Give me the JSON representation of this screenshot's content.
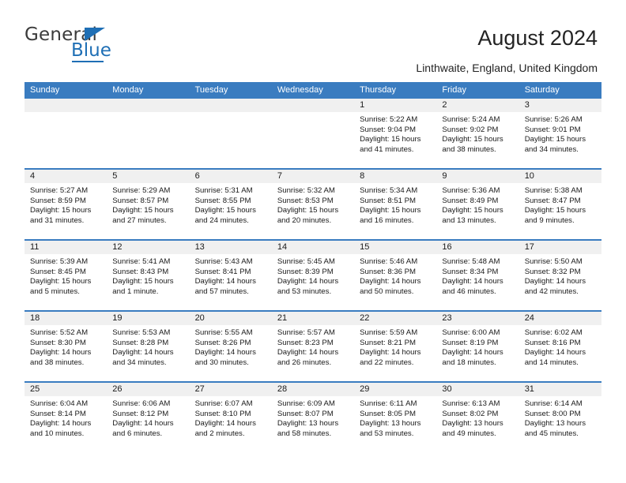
{
  "brand": {
    "name_part1": "General",
    "name_part2": "Blue",
    "accent_color": "#1f6fb5"
  },
  "header": {
    "title": "August 2024",
    "subtitle": "Linthwaite, England, United Kingdom"
  },
  "calendar": {
    "header_bg": "#3a7cc0",
    "daynum_bg": "#f0f0f0",
    "weekdays": [
      "Sunday",
      "Monday",
      "Tuesday",
      "Wednesday",
      "Thursday",
      "Friday",
      "Saturday"
    ],
    "weeks": [
      [
        {
          "day": "",
          "sunrise": "",
          "sunset": "",
          "daylight_line1": "",
          "daylight_line2": ""
        },
        {
          "day": "",
          "sunrise": "",
          "sunset": "",
          "daylight_line1": "",
          "daylight_line2": ""
        },
        {
          "day": "",
          "sunrise": "",
          "sunset": "",
          "daylight_line1": "",
          "daylight_line2": ""
        },
        {
          "day": "",
          "sunrise": "",
          "sunset": "",
          "daylight_line1": "",
          "daylight_line2": ""
        },
        {
          "day": "1",
          "sunrise": "Sunrise: 5:22 AM",
          "sunset": "Sunset: 9:04 PM",
          "daylight_line1": "Daylight: 15 hours",
          "daylight_line2": "and 41 minutes."
        },
        {
          "day": "2",
          "sunrise": "Sunrise: 5:24 AM",
          "sunset": "Sunset: 9:02 PM",
          "daylight_line1": "Daylight: 15 hours",
          "daylight_line2": "and 38 minutes."
        },
        {
          "day": "3",
          "sunrise": "Sunrise: 5:26 AM",
          "sunset": "Sunset: 9:01 PM",
          "daylight_line1": "Daylight: 15 hours",
          "daylight_line2": "and 34 minutes."
        }
      ],
      [
        {
          "day": "4",
          "sunrise": "Sunrise: 5:27 AM",
          "sunset": "Sunset: 8:59 PM",
          "daylight_line1": "Daylight: 15 hours",
          "daylight_line2": "and 31 minutes."
        },
        {
          "day": "5",
          "sunrise": "Sunrise: 5:29 AM",
          "sunset": "Sunset: 8:57 PM",
          "daylight_line1": "Daylight: 15 hours",
          "daylight_line2": "and 27 minutes."
        },
        {
          "day": "6",
          "sunrise": "Sunrise: 5:31 AM",
          "sunset": "Sunset: 8:55 PM",
          "daylight_line1": "Daylight: 15 hours",
          "daylight_line2": "and 24 minutes."
        },
        {
          "day": "7",
          "sunrise": "Sunrise: 5:32 AM",
          "sunset": "Sunset: 8:53 PM",
          "daylight_line1": "Daylight: 15 hours",
          "daylight_line2": "and 20 minutes."
        },
        {
          "day": "8",
          "sunrise": "Sunrise: 5:34 AM",
          "sunset": "Sunset: 8:51 PM",
          "daylight_line1": "Daylight: 15 hours",
          "daylight_line2": "and 16 minutes."
        },
        {
          "day": "9",
          "sunrise": "Sunrise: 5:36 AM",
          "sunset": "Sunset: 8:49 PM",
          "daylight_line1": "Daylight: 15 hours",
          "daylight_line2": "and 13 minutes."
        },
        {
          "day": "10",
          "sunrise": "Sunrise: 5:38 AM",
          "sunset": "Sunset: 8:47 PM",
          "daylight_line1": "Daylight: 15 hours",
          "daylight_line2": "and 9 minutes."
        }
      ],
      [
        {
          "day": "11",
          "sunrise": "Sunrise: 5:39 AM",
          "sunset": "Sunset: 8:45 PM",
          "daylight_line1": "Daylight: 15 hours",
          "daylight_line2": "and 5 minutes."
        },
        {
          "day": "12",
          "sunrise": "Sunrise: 5:41 AM",
          "sunset": "Sunset: 8:43 PM",
          "daylight_line1": "Daylight: 15 hours",
          "daylight_line2": "and 1 minute."
        },
        {
          "day": "13",
          "sunrise": "Sunrise: 5:43 AM",
          "sunset": "Sunset: 8:41 PM",
          "daylight_line1": "Daylight: 14 hours",
          "daylight_line2": "and 57 minutes."
        },
        {
          "day": "14",
          "sunrise": "Sunrise: 5:45 AM",
          "sunset": "Sunset: 8:39 PM",
          "daylight_line1": "Daylight: 14 hours",
          "daylight_line2": "and 53 minutes."
        },
        {
          "day": "15",
          "sunrise": "Sunrise: 5:46 AM",
          "sunset": "Sunset: 8:36 PM",
          "daylight_line1": "Daylight: 14 hours",
          "daylight_line2": "and 50 minutes."
        },
        {
          "day": "16",
          "sunrise": "Sunrise: 5:48 AM",
          "sunset": "Sunset: 8:34 PM",
          "daylight_line1": "Daylight: 14 hours",
          "daylight_line2": "and 46 minutes."
        },
        {
          "day": "17",
          "sunrise": "Sunrise: 5:50 AM",
          "sunset": "Sunset: 8:32 PM",
          "daylight_line1": "Daylight: 14 hours",
          "daylight_line2": "and 42 minutes."
        }
      ],
      [
        {
          "day": "18",
          "sunrise": "Sunrise: 5:52 AM",
          "sunset": "Sunset: 8:30 PM",
          "daylight_line1": "Daylight: 14 hours",
          "daylight_line2": "and 38 minutes."
        },
        {
          "day": "19",
          "sunrise": "Sunrise: 5:53 AM",
          "sunset": "Sunset: 8:28 PM",
          "daylight_line1": "Daylight: 14 hours",
          "daylight_line2": "and 34 minutes."
        },
        {
          "day": "20",
          "sunrise": "Sunrise: 5:55 AM",
          "sunset": "Sunset: 8:26 PM",
          "daylight_line1": "Daylight: 14 hours",
          "daylight_line2": "and 30 minutes."
        },
        {
          "day": "21",
          "sunrise": "Sunrise: 5:57 AM",
          "sunset": "Sunset: 8:23 PM",
          "daylight_line1": "Daylight: 14 hours",
          "daylight_line2": "and 26 minutes."
        },
        {
          "day": "22",
          "sunrise": "Sunrise: 5:59 AM",
          "sunset": "Sunset: 8:21 PM",
          "daylight_line1": "Daylight: 14 hours",
          "daylight_line2": "and 22 minutes."
        },
        {
          "day": "23",
          "sunrise": "Sunrise: 6:00 AM",
          "sunset": "Sunset: 8:19 PM",
          "daylight_line1": "Daylight: 14 hours",
          "daylight_line2": "and 18 minutes."
        },
        {
          "day": "24",
          "sunrise": "Sunrise: 6:02 AM",
          "sunset": "Sunset: 8:16 PM",
          "daylight_line1": "Daylight: 14 hours",
          "daylight_line2": "and 14 minutes."
        }
      ],
      [
        {
          "day": "25",
          "sunrise": "Sunrise: 6:04 AM",
          "sunset": "Sunset: 8:14 PM",
          "daylight_line1": "Daylight: 14 hours",
          "daylight_line2": "and 10 minutes."
        },
        {
          "day": "26",
          "sunrise": "Sunrise: 6:06 AM",
          "sunset": "Sunset: 8:12 PM",
          "daylight_line1": "Daylight: 14 hours",
          "daylight_line2": "and 6 minutes."
        },
        {
          "day": "27",
          "sunrise": "Sunrise: 6:07 AM",
          "sunset": "Sunset: 8:10 PM",
          "daylight_line1": "Daylight: 14 hours",
          "daylight_line2": "and 2 minutes."
        },
        {
          "day": "28",
          "sunrise": "Sunrise: 6:09 AM",
          "sunset": "Sunset: 8:07 PM",
          "daylight_line1": "Daylight: 13 hours",
          "daylight_line2": "and 58 minutes."
        },
        {
          "day": "29",
          "sunrise": "Sunrise: 6:11 AM",
          "sunset": "Sunset: 8:05 PM",
          "daylight_line1": "Daylight: 13 hours",
          "daylight_line2": "and 53 minutes."
        },
        {
          "day": "30",
          "sunrise": "Sunrise: 6:13 AM",
          "sunset": "Sunset: 8:02 PM",
          "daylight_line1": "Daylight: 13 hours",
          "daylight_line2": "and 49 minutes."
        },
        {
          "day": "31",
          "sunrise": "Sunrise: 6:14 AM",
          "sunset": "Sunset: 8:00 PM",
          "daylight_line1": "Daylight: 13 hours",
          "daylight_line2": "and 45 minutes."
        }
      ]
    ]
  }
}
